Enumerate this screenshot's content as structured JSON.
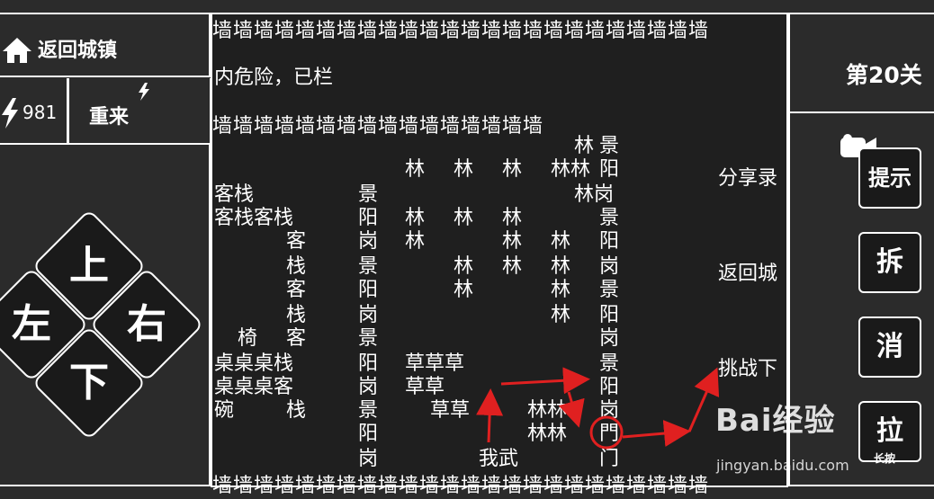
{
  "hud": {
    "home_label": "返回城镇",
    "energy_value": "981",
    "restart_label": "重来",
    "level_label": "第20关"
  },
  "dpad": {
    "up": "上",
    "left": "左",
    "right": "右",
    "down": "下"
  },
  "side_buttons": {
    "hint": "提示",
    "demolish": "拆",
    "eliminate": "消",
    "pull": "拉",
    "long_press": "长按"
  },
  "board": {
    "top_wall": "墙墙墙墙墙墙墙墙墙墙墙墙墙墙墙墙墙墙墙墙墙墙墙墙",
    "inner_wall": "墙墙墙墙墙墙墙墙墙墙墙墙墙墙墙墙",
    "bottom_wall": "墙墙墙墙墙墙墙墙墙墙墙墙墙墙墙墙墙墙墙墙墙墙墙墙",
    "notice": "内危险，已栏",
    "share": "分享录",
    "return_city": "返回城",
    "challenge": "挑战下",
    "player": "我武",
    "gate": "門",
    "gate2": "门"
  },
  "watermark": {
    "logo": "Bai经验",
    "url": "jingyan.baidu.com"
  }
}
